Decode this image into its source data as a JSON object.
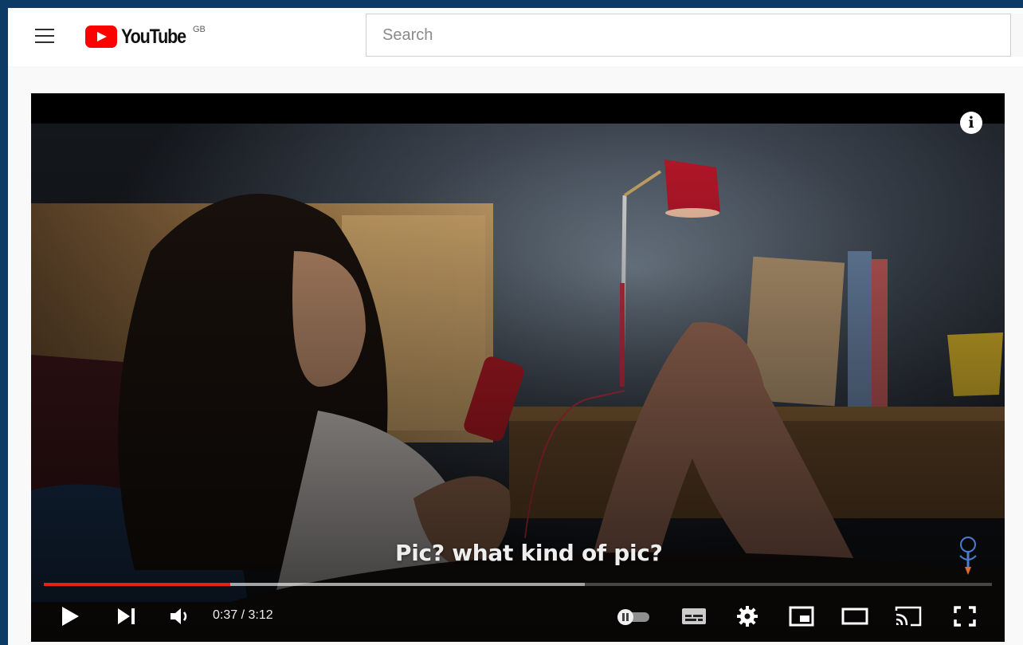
{
  "masthead": {
    "logo_text": "YouTube",
    "country_code": "GB",
    "search_placeholder": "Search"
  },
  "player": {
    "caption": "Pic? what kind of pic?",
    "current_time": "0:37",
    "duration": "3:12",
    "time_display": "0:37 / 3:12",
    "progress_fraction": 0.197,
    "buffered_fraction": 0.571,
    "autoplay": "on",
    "controls": [
      "play",
      "next",
      "volume",
      "autoplay-toggle",
      "subtitles",
      "settings",
      "miniplayer",
      "theater-mode",
      "cast",
      "fullscreen"
    ]
  },
  "colors": {
    "brand_red": "#ff0000",
    "progress_red": "#e62117",
    "page_border": "#0c3b66"
  }
}
